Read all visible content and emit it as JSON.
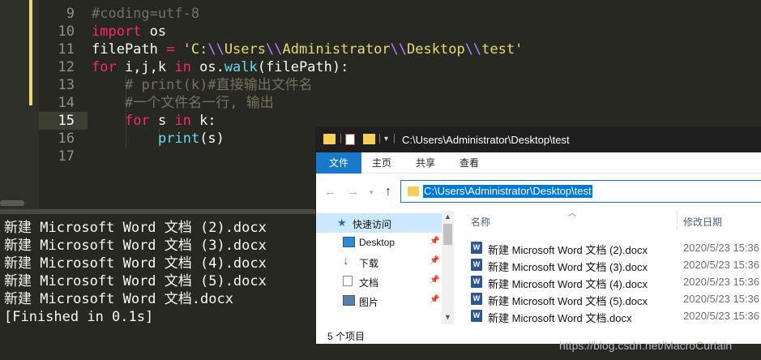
{
  "editor": {
    "line_numbers": [
      "9",
      "10",
      "11",
      "12",
      "13",
      "14",
      "15",
      "16",
      "17"
    ],
    "active_line": "15",
    "code": {
      "l9": "#coding=utf-8",
      "l10_kw": "import",
      "l10_rest": " os",
      "l11_var": "filePath ",
      "l11_eq": "=",
      "l11_q1": " 'C:",
      "l11_e1": "\\\\",
      "l11_s1": "Users",
      "l11_e2": "\\\\",
      "l11_s2": "Administrator",
      "l11_e3": "\\\\",
      "l11_s3": "Desktop",
      "l11_e4": "\\\\",
      "l11_s4": "test'",
      "l12_for": "for",
      "l12_vars": " i,j,k ",
      "l12_in": "in",
      "l12_os": " os.",
      "l12_walk": "walk",
      "l12_args": "(filePath):",
      "l13": "# print(k)#直接输出文件名",
      "l14": "#一个文件名一行, 输出",
      "l15_for": "for",
      "l15_s": " s ",
      "l15_in": "in",
      "l15_k": " k:",
      "l16_print": "print",
      "l16_args": "(s)"
    }
  },
  "console": {
    "lines": [
      "新建 Microsoft Word 文档 (2).docx",
      "新建 Microsoft Word 文档 (3).docx",
      "新建 Microsoft Word 文档 (4).docx",
      "新建 Microsoft Word 文档 (5).docx",
      "新建 Microsoft Word 文档.docx",
      "[Finished in 0.1s]"
    ]
  },
  "explorer": {
    "title": "C:\\Users\\Administrator\\Desktop\\test",
    "tabs": [
      "文件",
      "主页",
      "共享",
      "查看"
    ],
    "address": "C:\\Users\\Administrator\\Desktop\\test",
    "nav_items": [
      {
        "label": "快速访问",
        "icon": "star-icon"
      },
      {
        "label": "Desktop",
        "icon": "desktop-icon"
      },
      {
        "label": "下载",
        "icon": "download-icon"
      },
      {
        "label": "文档",
        "icon": "document-icon"
      },
      {
        "label": "图片",
        "icon": "picture-icon"
      }
    ],
    "columns": {
      "name": "名称",
      "date": "修改日期"
    },
    "files": [
      {
        "name": "新建 Microsoft Word 文档 (2).docx",
        "date": "2020/5/23 15:36"
      },
      {
        "name": "新建 Microsoft Word 文档 (3).docx",
        "date": "2020/5/23 15:36"
      },
      {
        "name": "新建 Microsoft Word 文档 (4).docx",
        "date": "2020/5/23 15:36"
      },
      {
        "name": "新建 Microsoft Word 文档 (5).docx",
        "date": "2020/5/23 15:36"
      },
      {
        "name": "新建 Microsoft Word 文档.docx",
        "date": "2020/5/23 15:36"
      }
    ],
    "status": "5 个项目",
    "accent": "#1979ca"
  },
  "watermark": "https://blog.csdn.net/MacroCurtain"
}
